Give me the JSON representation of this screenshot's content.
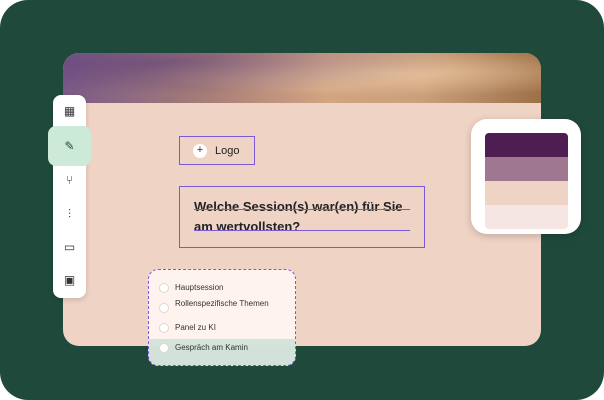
{
  "sidebar": {
    "tools": [
      {
        "icon": "chart-icon",
        "glyph": "▦"
      },
      {
        "icon": "brush-icon",
        "glyph": "✎"
      },
      {
        "icon": "branch-icon",
        "glyph": "⑂"
      },
      {
        "icon": "sliders-icon",
        "glyph": "⫶"
      },
      {
        "icon": "inbox-icon",
        "glyph": "▭"
      },
      {
        "icon": "grid-icon",
        "glyph": "▣"
      }
    ],
    "active_index": 1
  },
  "logo": {
    "plus_glyph": "+",
    "label": "Logo"
  },
  "question": {
    "text": "Welche Session(s) war(en) für Sie am wertvollsten?"
  },
  "options": [
    {
      "label": "Hauptsession"
    },
    {
      "label": "Rollenspezifische Themen"
    },
    {
      "label": "Panel zu KI"
    },
    {
      "label": "Gespräch am Kamin"
    }
  ],
  "palette": {
    "colors": [
      "#4e1e52",
      "#a07790",
      "#efd3c5",
      "#f6e6e3"
    ]
  },
  "colors": {
    "background": "#1f4a3b",
    "card": "#efd3c5",
    "selection": "#7a5ad6",
    "active_tool": "#cde9d7"
  }
}
